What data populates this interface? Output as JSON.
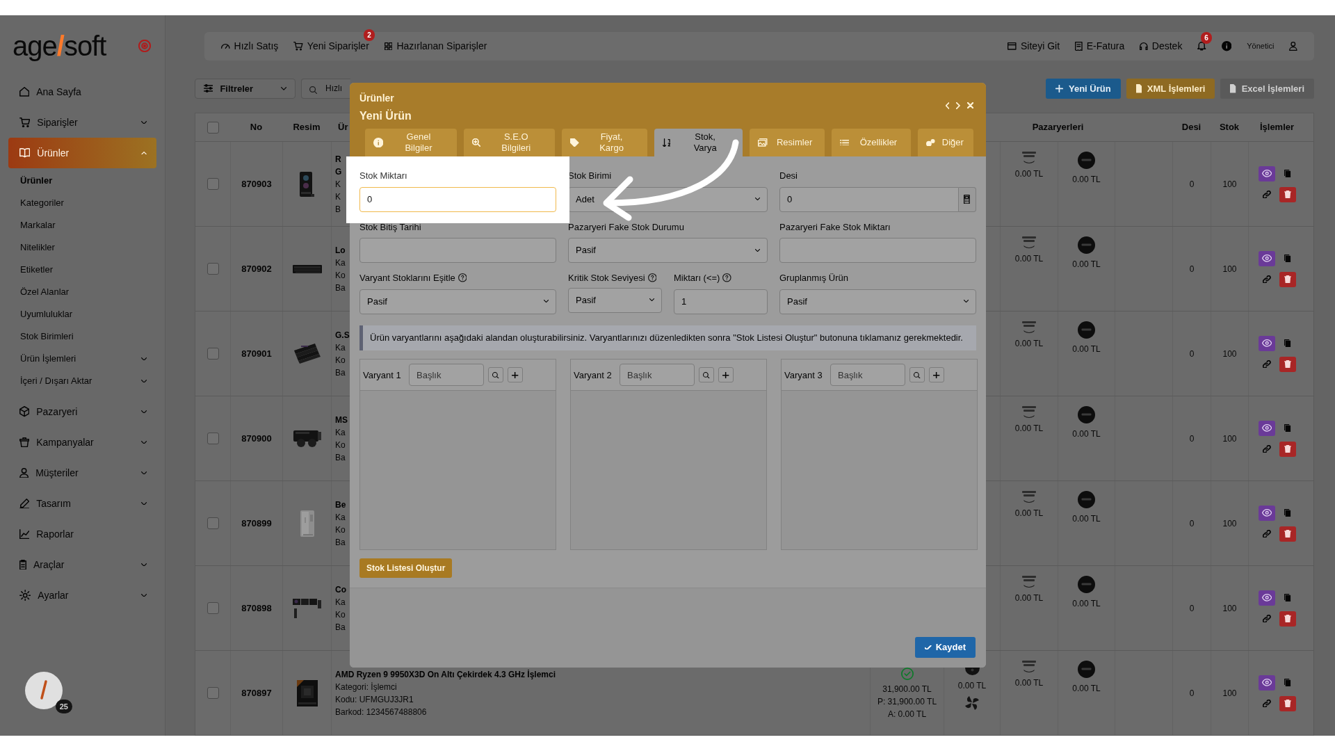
{
  "sidebar": {
    "logo": {
      "prefix": "age",
      "slash": "/",
      "suffix": "soft"
    },
    "items": [
      {
        "label": "Ana Sayfa",
        "selected": false
      },
      {
        "label": "Siparişler",
        "selected": false,
        "expanded": false
      },
      {
        "label": "Ürünler",
        "selected": true,
        "expanded": true,
        "children": [
          {
            "label": "Ürünler",
            "selected": true
          },
          {
            "label": "Kategoriler",
            "selected": false
          },
          {
            "label": "Markalar",
            "selected": false
          },
          {
            "label": "Nitelikler",
            "selected": false
          },
          {
            "label": "Etiketler",
            "selected": false
          },
          {
            "label": "Özel Alanlar",
            "selected": false
          },
          {
            "label": "Uyumluluklar",
            "selected": false
          },
          {
            "label": "Stok Birimleri",
            "selected": false
          },
          {
            "label": "Ürün İşlemleri",
            "selected": false,
            "expanded": false
          },
          {
            "label": "İçeri / Dışarı Aktar",
            "selected": false,
            "expanded": false
          }
        ]
      },
      {
        "label": "Pazaryeri",
        "selected": false,
        "expanded": false
      },
      {
        "label": "Kampanyalar",
        "selected": false,
        "expanded": false
      },
      {
        "label": "Müşteriler",
        "selected": false,
        "expanded": false
      },
      {
        "label": "Tasarım",
        "selected": false,
        "expanded": false
      },
      {
        "label": "Raporlar",
        "selected": false
      },
      {
        "label": "Araçlar",
        "selected": false,
        "expanded": false
      },
      {
        "label": "Ayarlar",
        "selected": false,
        "expanded": false
      }
    ],
    "badge": "25"
  },
  "top_bar": {
    "links": [
      {
        "label": "Hızlı Satış"
      },
      {
        "label": "Yeni Siparişler",
        "badge": "2"
      },
      {
        "label": "Hazırlanan Siparişler"
      }
    ],
    "right_links": [
      {
        "label": "Siteyi Git"
      },
      {
        "label": "E-Fatura"
      },
      {
        "label": "Destek"
      }
    ],
    "notification_badge": "6",
    "user": "Yönetici"
  },
  "toolbar": {
    "filter": "Filtreler",
    "search": {
      "placeholder": "Hızlı"
    },
    "buttons": [
      {
        "label": "Yeni Ürün",
        "kind": "primary"
      },
      {
        "label": "XML İşlemleri",
        "kind": "warning"
      },
      {
        "label": "Excel İşlemleri",
        "kind": "secondary"
      }
    ]
  },
  "table": {
    "columns": {
      "no": "No",
      "image": "Resim",
      "product": "Ür",
      "marketplaces": "Pazaryerleri",
      "desi": "Desi",
      "stock": "Stok",
      "actions": "İşlemler"
    },
    "select_all_checked": false,
    "rows": [
      {
        "checked": false,
        "no": "870903",
        "name_lines": [
          "R",
          "G"
        ],
        "detail_lines": [
          "K",
          "K",
          "B"
        ],
        "marketplace_2": "0.00 TL",
        "marketplace_3": "0.00 TL",
        "desi": "0",
        "stock": "100"
      },
      {
        "checked": false,
        "no": "870902",
        "name_lines": [
          "Lo"
        ],
        "detail_lines": [
          "Ka",
          "Ko",
          "Ba"
        ],
        "marketplace_2": "0.00 TL",
        "marketplace_3": "0.00 TL",
        "desi": "0",
        "stock": "100"
      },
      {
        "checked": false,
        "no": "870901",
        "name_lines": [
          "G.S"
        ],
        "detail_lines": [
          "Ka",
          "Ko",
          "Ba"
        ],
        "marketplace_2": "0.00 TL",
        "marketplace_3": "0.00 TL",
        "desi": "0",
        "stock": "100"
      },
      {
        "checked": false,
        "no": "870900",
        "name_lines": [
          "MS"
        ],
        "detail_lines": [
          "Ka",
          "Ko",
          "Ba"
        ],
        "marketplace_2": "0.00 TL",
        "marketplace_3": "0.00 TL",
        "desi": "0",
        "stock": "100"
      },
      {
        "checked": false,
        "no": "870899",
        "name_lines": [
          "Be"
        ],
        "detail_lines": [
          "Ka",
          "Ko",
          "Ba"
        ],
        "marketplace_2": "0.00 TL",
        "marketplace_3": "0.00 TL",
        "desi": "0",
        "stock": "100"
      },
      {
        "checked": false,
        "no": "870898",
        "name_lines": [
          "Co"
        ],
        "detail_lines": [
          "Ka",
          "Ko",
          "Ba"
        ],
        "marketplace_2": "0.00 TL",
        "marketplace_3": "0.00 TL",
        "desi": "0",
        "stock": "100"
      },
      {
        "checked": false,
        "no": "870897",
        "name_lines": [
          "AMD Ryzen 9 9950X3D On Altı Çekirdek 4.3 GHz İşlemci"
        ],
        "detail_lines": [
          "Kategori: İşlemci",
          "Kodu: UFMGUJ3JR1",
          "Barkod: 1234567488806"
        ],
        "price_lines": [
          "31,900.00 TL",
          "P: 31,900.00 TL",
          "A: 0.00 TL"
        ],
        "marketplace_1": "0.00 TL",
        "marketplace_2": "0.00 TL",
        "marketplace_3": "0.00 TL",
        "desi": "0",
        "stock": "100"
      }
    ]
  },
  "modal": {
    "section": "Ürünler",
    "title": "Yeni Ürün",
    "tabs": [
      {
        "label": "Genel Bilgiler",
        "selected": false
      },
      {
        "label": "S.E.O Bilgileri",
        "selected": false
      },
      {
        "label": "Fiyat, Kargo",
        "selected": false
      },
      {
        "label": "Stok, Varya",
        "selected": true
      },
      {
        "label": "Resimler",
        "selected": false
      },
      {
        "label": "Özellikler",
        "selected": false
      },
      {
        "label": "Diğer",
        "selected": false
      }
    ],
    "fields": [
      {
        "label": "Stok Miktarı",
        "kind": "input",
        "value": "0",
        "help": false,
        "highlighted": true
      },
      {
        "label": "Stok Birimi",
        "kind": "select",
        "value": "Adet",
        "help": false,
        "highlighted": false
      },
      {
        "label": "Desi",
        "kind": "calc",
        "value": "0",
        "help": false,
        "highlighted": false
      },
      {
        "label": "Stok Bitiş Tarihi",
        "kind": "input",
        "help": false,
        "highlighted": false
      },
      {
        "label": "Pazaryeri Fake Stok Durumu",
        "kind": "select",
        "value": "Pasif",
        "help": false,
        "highlighted": false
      },
      {
        "label": "Pazaryeri Fake Stok Miktarı",
        "kind": "input",
        "help": false,
        "highlighted": false
      },
      {
        "label": "Varyant Stoklarını Eşitle",
        "kind": "select",
        "value": "Pasif",
        "help": true,
        "highlighted": false
      },
      {
        "label": "Kritik Stok Seviyesi",
        "kind": "select",
        "value": "Pasif",
        "help": true,
        "highlighted": false
      },
      {
        "label": "Miktarı (<=)",
        "kind": "input",
        "value": "1",
        "help": true,
        "highlighted": false
      },
      {
        "label": "Gruplanmış Ürün",
        "kind": "select",
        "value": "Pasif",
        "help": false,
        "highlighted": false
      }
    ],
    "notice": "Ürün varyantlarını aşağıdaki alandan oluşturabilirsiniz. Varyantlarınızı düzenledikten sonra \"Stok Listesi Oluştur\" butonuna tıklamanız gerekmektedir.",
    "variants": [
      {
        "label": "Varyant 1",
        "placeholder": "Başlık"
      },
      {
        "label": "Varyant 2",
        "placeholder": "Başlık"
      },
      {
        "label": "Varyant 3",
        "placeholder": "Başlık"
      }
    ],
    "build_button": "Stok Listesi Oluştur",
    "save_button": "Kaydet"
  }
}
